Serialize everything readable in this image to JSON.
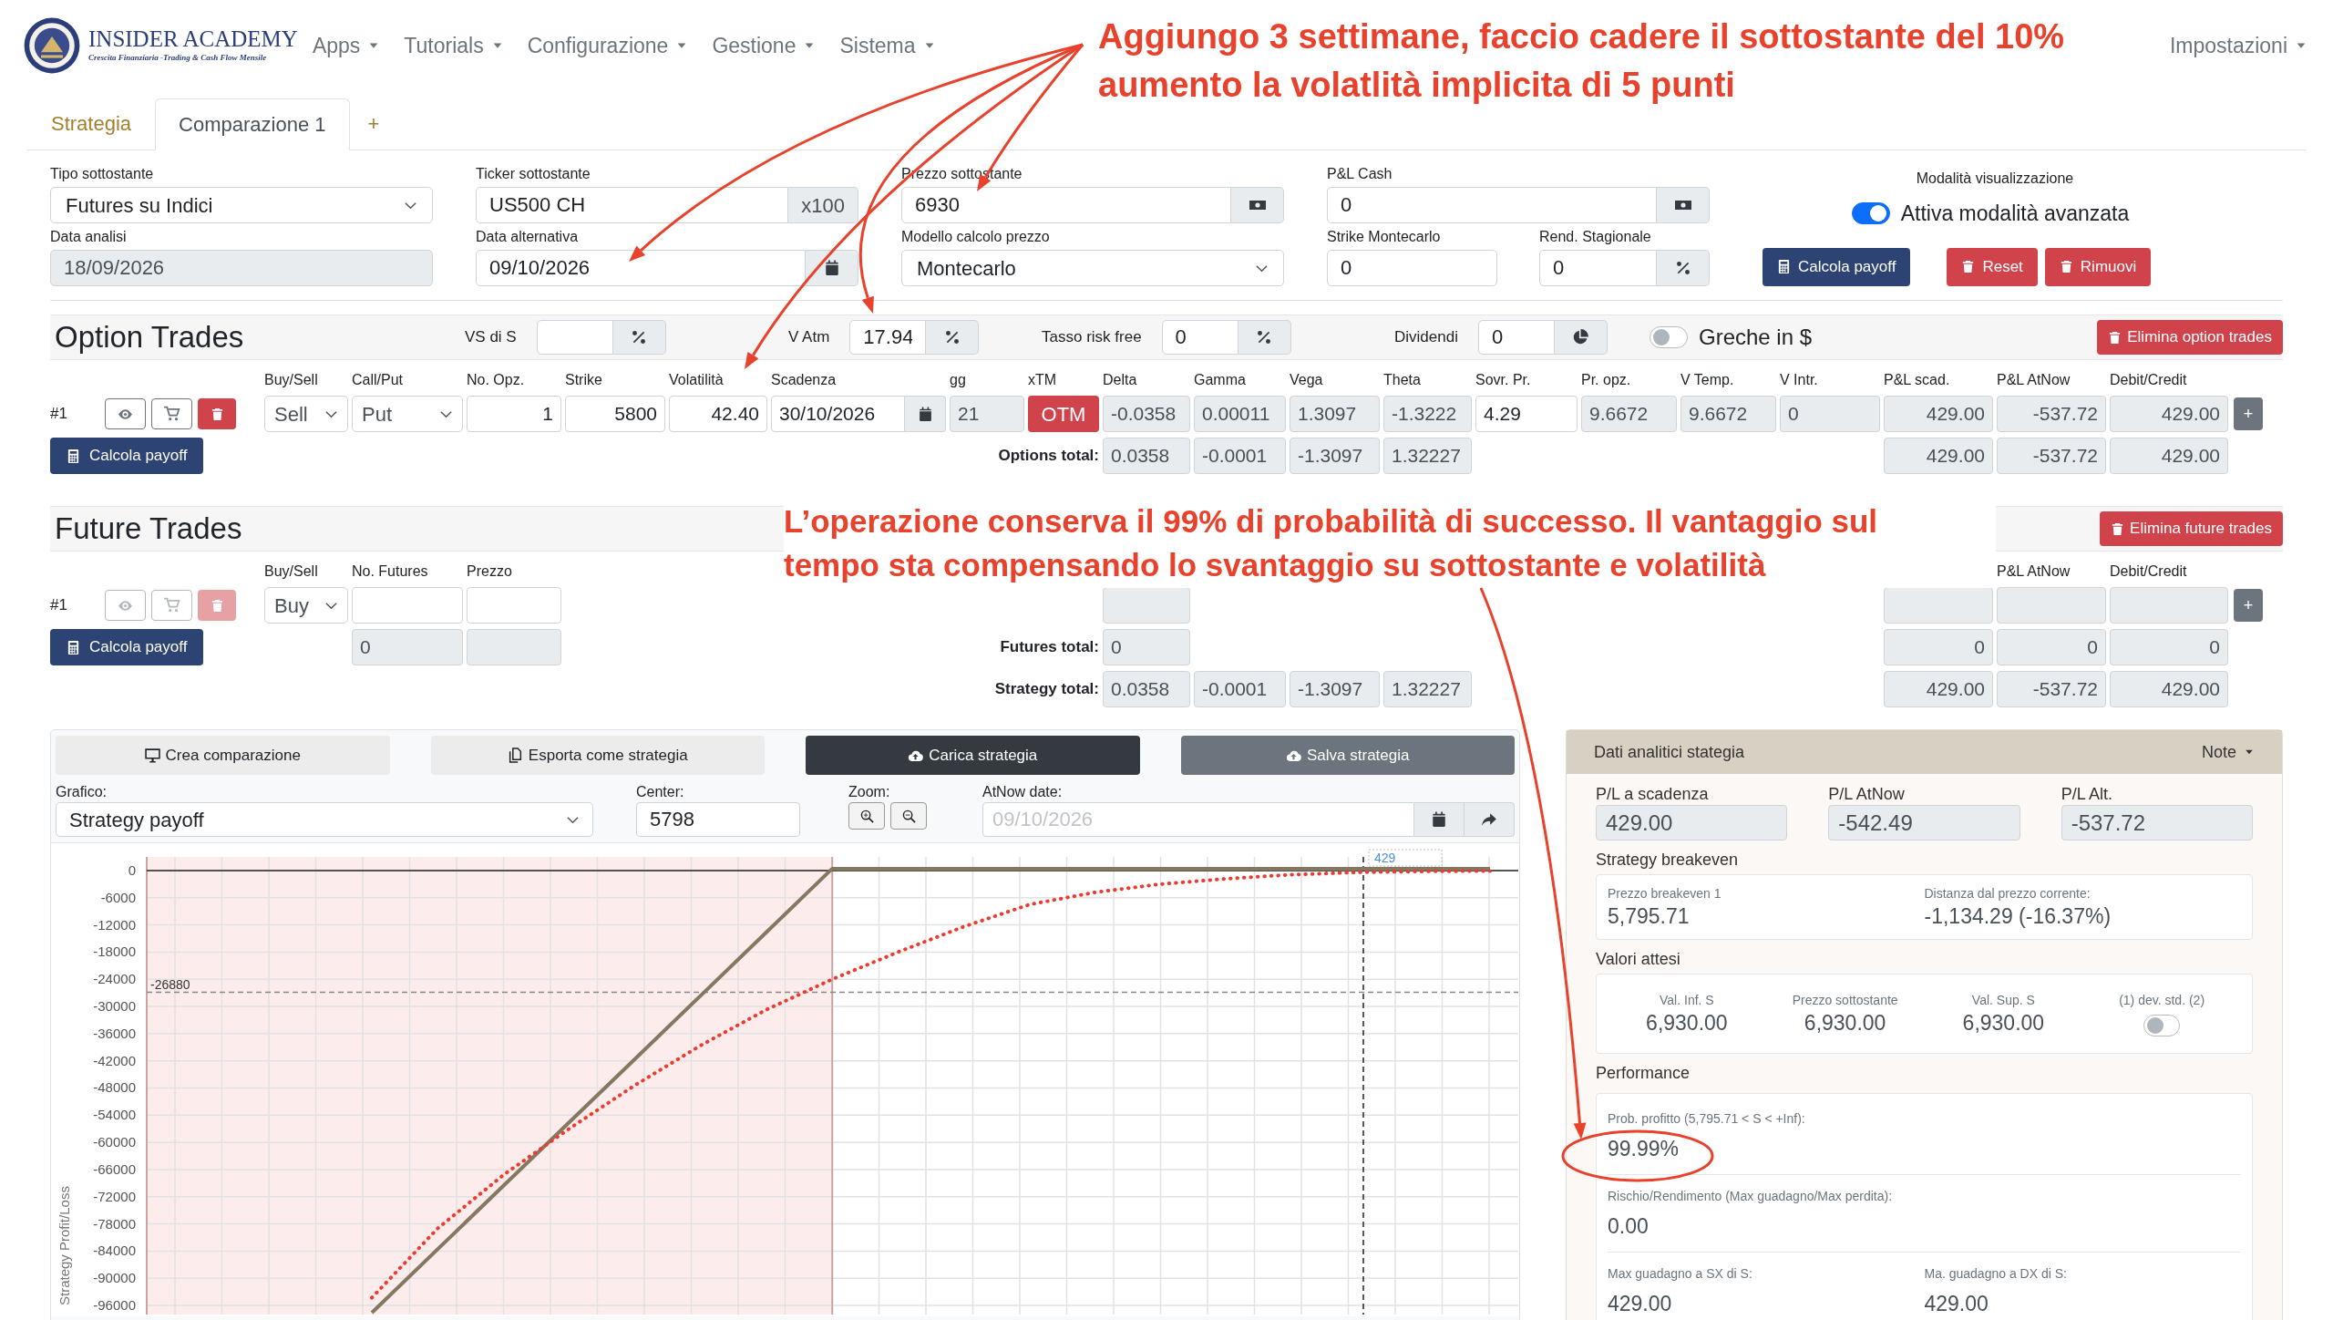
{
  "navbar": {
    "brand_title": "INSIDER ACADEMY",
    "brand_tagline": "Crescita Finanziaria -Trading & Cash Flow Mensile",
    "menus": [
      "Apps",
      "Tutorials",
      "Configurazione",
      "Gestione",
      "Sistema"
    ],
    "right_menu": "Impostazioni"
  },
  "annotations": [
    {
      "text": "Aggiungo 3 settimane, faccio cadere il sottostante del 10%\naumento la volatlità implicita di 5 punti"
    },
    {
      "text": "L’operazione conserva il 99% di probabilità di successo. Il vantaggio sul\ntempo sta compensando lo svantaggio su sottostante e volatilità"
    }
  ],
  "tabs": [
    {
      "label": "Strategia",
      "selected": false
    },
    {
      "label": "Comparazione 1",
      "selected": true
    }
  ],
  "add_tab": "+",
  "form_columns": [
    [
      {
        "label": "Tipo sottostante",
        "value": "Futures su Indici",
        "kind": "select"
      },
      {
        "label": "Data analisi",
        "value": "18/09/2026",
        "kind": "readonly"
      }
    ],
    [
      {
        "label": "Ticker sottostante",
        "value": "US500 CH",
        "kind": "addon-text",
        "addon": "x100"
      },
      {
        "label": "Data alternativa",
        "value": "09/10/2026",
        "kind": "addon-calendar"
      }
    ],
    [
      {
        "label": "Prezzo sottostante",
        "value": "6930",
        "kind": "addon-money"
      },
      {
        "label": "Modello calcolo prezzo",
        "value": "Montecarlo",
        "kind": "select"
      }
    ],
    [
      {
        "label": "P&L Cash",
        "value": "0",
        "kind": "addon-money"
      },
      {
        "kind": "pair",
        "fields": [
          {
            "label": "Strike Montecarlo",
            "value": "0",
            "kind": "input"
          },
          {
            "label": "Rend. Stagionale",
            "value": "0",
            "kind": "addon-percent"
          }
        ]
      }
    ]
  ],
  "view_mode": {
    "label": "Modalità visualizzazione",
    "toggle_label": "Attiva modalità avanzata",
    "on": true
  },
  "actions": [
    {
      "label": "Calcola payoff",
      "kind": "primary"
    },
    {
      "label": "Reset",
      "kind": "danger"
    },
    {
      "label": "Rimuovi",
      "kind": "danger"
    }
  ],
  "option_trades": {
    "title": "Option Trades",
    "params": [
      {
        "label": "VS di S",
        "kind": "addon-percent"
      },
      {
        "label": "V Atm",
        "value": "17.94",
        "kind": "addon-percent"
      },
      {
        "label": "Tasso risk free",
        "value": "0",
        "kind": "addon-percent"
      },
      {
        "label": "Dividendi",
        "value": "0",
        "kind": "addon-pie"
      }
    ],
    "greeks_toggle": {
      "label": "Greche in $",
      "on": false
    },
    "delete_label": "Elimina option trades",
    "columns": [
      "Buy/Sell",
      "Call/Put",
      "No. Opz.",
      "Strike",
      "Volatilità",
      "Scadenza",
      "gg",
      "xTM",
      "Delta",
      "Gamma",
      "Vega",
      "Theta",
      "Sovr. Pr.",
      "Pr. opz.",
      "V Temp.",
      "V Intr.",
      "P&L scad.",
      "P&L AtNow",
      "Debit/Credit"
    ],
    "rows": [
      {
        "index": "#1",
        "actions_disabled": false,
        "add_label": "+",
        "cells": [
          "Sell",
          "Put",
          "1",
          "5800",
          "42.40",
          "30/10/2026",
          "21",
          "OTM",
          "-0.0358",
          "0.00011",
          "1.3097",
          "-1.3222",
          "4.29",
          "9.6672",
          "9.6672",
          "0",
          "429.00",
          "-537.72",
          "429.00"
        ]
      }
    ],
    "calc_label": "Calcola payoff",
    "total_label": "Options total:",
    "totals_greeks": [
      "0.0358",
      "-0.0001",
      "-1.3097",
      "1.32227"
    ],
    "totals_pl": [
      "429.00",
      "-537.72",
      "429.00"
    ]
  },
  "future_trades": {
    "title": "Future Trades",
    "delete_label": "Elimina future trades",
    "columns": [
      "Buy/Sell",
      "No. Futures",
      "Prezzo"
    ],
    "right_columns": [
      "P&L AtNow",
      "Debit/Credit"
    ],
    "rows": [
      {
        "index": "#1",
        "actions_disabled": true,
        "add_label": "+",
        "buy_sell": "Buy"
      }
    ],
    "calc_label": "Calcola payoff",
    "qty_total": "0",
    "total_label": "Futures total:",
    "delta_total": "0",
    "totals_pl": [
      "0",
      "0",
      "0"
    ]
  },
  "strategy_total": {
    "label": "Strategy total:",
    "greeks": [
      "0.0358",
      "-0.0001",
      "-1.3097",
      "1.32227"
    ],
    "pl": [
      "429.00",
      "-537.72",
      "429.00"
    ]
  },
  "chart_panel": {
    "buttons": [
      {
        "label": "Crea comparazione",
        "kind": "light"
      },
      {
        "label": "Esporta come strategia",
        "kind": "light-copy"
      },
      {
        "label": "Carica strategia",
        "kind": "dark"
      },
      {
        "label": "Salva strategia",
        "kind": "secondary"
      }
    ],
    "grafico": {
      "label": "Grafico:",
      "value": "Strategy payoff"
    },
    "center": {
      "label": "Center:",
      "value": "5798"
    },
    "zoom_label": "Zoom:",
    "atnow": {
      "label": "AtNow date:",
      "value": "09/10/2026",
      "disabled": true
    },
    "chart_data": {
      "type": "line",
      "ylabel": "Strategy Profit/Loss",
      "categories": [
        null,
        null,
        null,
        null,
        null,
        null,
        null,
        null,
        null,
        null,
        null,
        null,
        null,
        null,
        null,
        null,
        null,
        null
      ],
      "ylim": [
        -98000,
        3000
      ],
      "yticks": [
        0,
        -6000,
        -12000,
        -18000,
        -24000,
        -30000,
        -36000,
        -42000,
        -48000,
        -54000,
        -60000,
        -66000,
        -72000,
        -78000,
        -84000,
        -90000,
        -96000
      ],
      "grid": true,
      "series": [
        {
          "color": "#857760",
          "line_style": "solid",
          "values": [
            -97600,
            -83600,
            -69600,
            -55600,
            -41600,
            -27600,
            -13600,
            400,
            400,
            400,
            400,
            400,
            400,
            400,
            400,
            400,
            400,
            400
          ]
        },
        {
          "color": "#ee3b30",
          "line_style": "dotted",
          "values": [
            -94300,
            -79000,
            -67200,
            -57000,
            -47400,
            -38600,
            -30700,
            -24000,
            -18000,
            -12400,
            -7500,
            -4800,
            -3000,
            -1800,
            -900,
            -400,
            -200,
            -100
          ]
        }
      ],
      "ref_lines": [
        {
          "axis": "y",
          "value": -26880,
          "label": "-26880"
        }
      ],
      "annotations": [
        "429"
      ]
    }
  },
  "analytics": {
    "title": "Dati analitici stategia",
    "note_menu": "Note",
    "pl": [
      {
        "label": "P/L a scadenza",
        "value": "429.00"
      },
      {
        "label": "P/L AtNow",
        "value": "-542.49"
      },
      {
        "label": "P/L Alt.",
        "value": "-537.72"
      }
    ],
    "breakeven": {
      "title": "Strategy breakeven",
      "items": [
        {
          "label": "Prezzo breakeven 1",
          "value": "5,795.71"
        },
        {
          "label": "Distanza dal prezzo corrente:",
          "value": "-1,134.29 (-16.37%)"
        }
      ]
    },
    "expected": {
      "title": "Valori attesi",
      "items": [
        {
          "label": "Val. Inf. S",
          "value": "6,930.00"
        },
        {
          "label": "Prezzo sottostante",
          "value": "6,930.00"
        },
        {
          "label": "Val. Sup. S",
          "value": "6,930.00"
        }
      ],
      "toggle_label": "(1) dev. std. (2)",
      "toggle_on": false
    },
    "performance": {
      "title": "Performance",
      "rows": [
        [
          {
            "label": "Prob. profitto (5,795.71 < S < +Inf):",
            "value": "99.99%"
          }
        ],
        [
          {
            "label": "Rischio/Rendimento (Max guadagno/Max perdita):",
            "value": "0.00"
          }
        ],
        [
          {
            "label": "Max guadagno a SX di S:",
            "value": "429.00"
          },
          {
            "label": "Ma. guadagno a DX di S:",
            "value": "429.00"
          }
        ]
      ]
    }
  }
}
